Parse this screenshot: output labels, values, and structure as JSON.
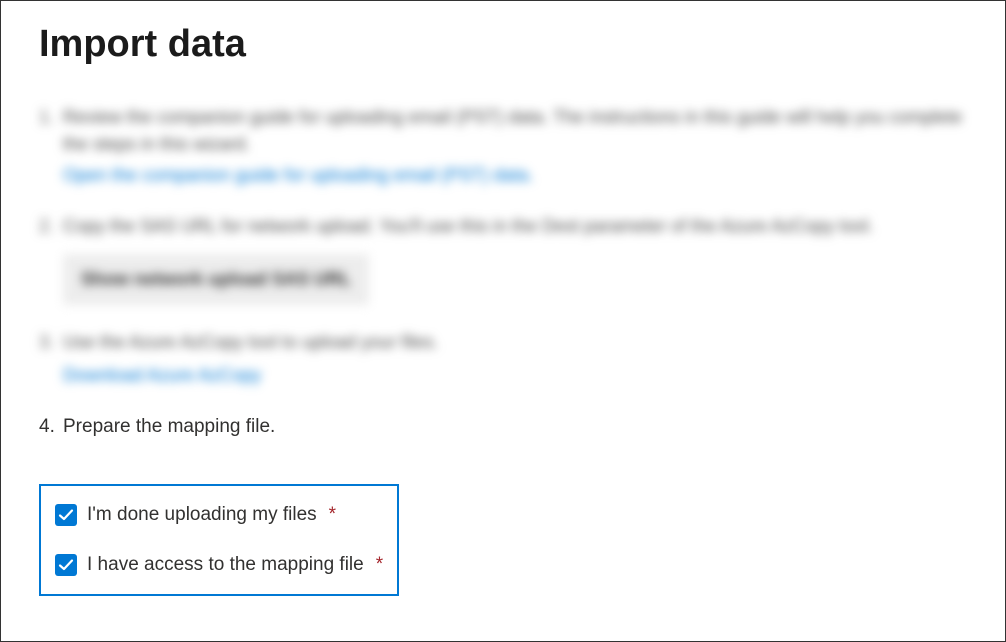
{
  "title": "Import data",
  "steps": {
    "step1": {
      "text": "Review the companion guide for uploading email (PST) data. The instructions in this guide will help you complete the steps in this wizard.",
      "link": "Open the companion guide for uploading email (PST) data."
    },
    "step2": {
      "text": "Copy the SAS URL for network upload. You'll use this in the Dest parameter of the Azure AzCopy tool.",
      "button": "Show network upload SAS URL"
    },
    "step3": {
      "text": "Use the Azure AzCopy tool to upload your files.",
      "link": "Download Azure AzCopy"
    },
    "step4": {
      "text": "Prepare the mapping file."
    }
  },
  "checkboxes": {
    "done_uploading": {
      "label": "I'm done uploading my files",
      "required": "*",
      "checked": true
    },
    "mapping_access": {
      "label": "I have access to the mapping file",
      "required": "*",
      "checked": true
    }
  }
}
